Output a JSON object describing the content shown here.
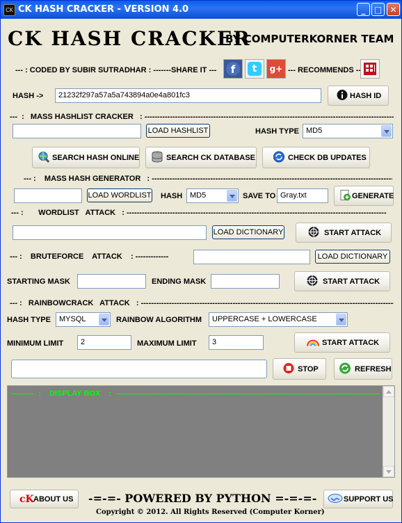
{
  "window": {
    "title": "CK HASH CRACKER - VERSION 4.0"
  },
  "header": {
    "app_name": "CK HASH CRACKER",
    "by_line": "BY COMPUTERKORNER TEAM"
  },
  "credits": {
    "coded_by": "--- : CODED BY SUBIR SUTRADHAR : -------SHARE IT ---",
    "recommends": "--- RECOMMENDS ---"
  },
  "social": {
    "facebook": "f",
    "twitter": "t",
    "google": "g+"
  },
  "hash_row": {
    "label": "HASH ->",
    "value": "21232f297a57a5a743894a0e4a801fc3",
    "button": "HASH ID"
  },
  "mass_hashlist": {
    "section": "---  :   MASS HASHLIST CRACKER   : -------------------------------------------------------------------------------------------------------------",
    "input_value": "",
    "load_button": "LOAD HASHLIST",
    "type_label": "HASH TYPE",
    "type_value": "MD5"
  },
  "online_buttons": {
    "search_online": "SEARCH HASH ONLINE",
    "search_db": "SEARCH CK DATABASE",
    "check_updates": "CHECK DB UPDATES"
  },
  "generator": {
    "section": "--- :    MASS HASH GENERATOR   : ---------------------------------------------------------------------------------------------------",
    "input_value": "",
    "load_button": "LOAD WORDLIST",
    "hash_label": "HASH",
    "hash_value": "MD5",
    "save_label": "SAVE TO",
    "save_value": "Gray.txt",
    "generate_button": "GENERATE"
  },
  "wordlist": {
    "section": "--- :       WORDLIST   ATTACK   : -----------------------------------------------------------------------------------------------------------------",
    "input_value": "",
    "load_button": "LOAD DICTIONARY",
    "start_button": "START ATTACK"
  },
  "bruteforce": {
    "section_left": "--- :    BRUTEFORCE    ATTACK    : -------------",
    "input_value": "",
    "load_button": "LOAD DICTIONARY",
    "starting_label": "STARTING MASK",
    "starting_value": "",
    "ending_label": "ENDING MASK",
    "ending_value": "",
    "start_button": "START ATTACK"
  },
  "rainbow": {
    "section": "--- :   RAINBOWCRACK   ATTACK   : -----------------------------------------------------------------------------------------------------------",
    "type_label": "HASH TYPE",
    "type_value": "MYSQL",
    "algo_label": "RAINBOW ALGORITHM",
    "algo_value": "UPPERCASE + LOWERCASE",
    "min_label": "MINIMUM LIMIT",
    "min_value": "2",
    "max_label": "MAXIMUM LIMIT",
    "max_value": "3",
    "start_button": "START ATTACK"
  },
  "progress": {
    "value": "",
    "stop_button": "STOP",
    "refresh_button": "REFRESH"
  },
  "display_box": {
    "header": "---------  :    DISPLAY BOX    :  -----------------------------------------------------------------------------------------------------------"
  },
  "footer": {
    "about_button": "ABOUT US",
    "powered": "-=-=- POWERED BY PYTHON =-=-=-",
    "support_button": "SUPPORT US",
    "copyright": "Copyright © 2012. All Rights Reserved (Computer Korner)"
  }
}
